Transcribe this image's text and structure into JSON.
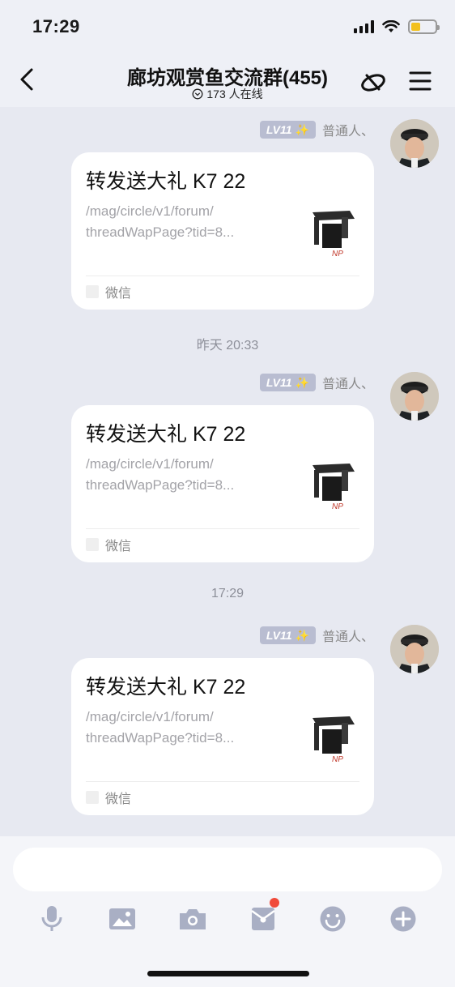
{
  "status_bar": {
    "time": "17:29"
  },
  "header": {
    "title": "廊坊观赏鱼交流群(455)",
    "online_text": "173 人在线"
  },
  "messages": [
    {
      "level": "LV11",
      "sender": "普通人、",
      "card_title": "转发送大礼 K7 22",
      "card_desc_line1": "/mag/circle/v1/forum/",
      "card_desc_line2": "threadWapPage?tid=8...",
      "card_source": "微信"
    },
    {
      "level": "LV11",
      "sender": "普通人、",
      "card_title": "转发送大礼 K7 22",
      "card_desc_line1": "/mag/circle/v1/forum/",
      "card_desc_line2": "threadWapPage?tid=8...",
      "card_source": "微信"
    },
    {
      "level": "LV11",
      "sender": "普通人、",
      "card_title": "转发送大礼 K7 22",
      "card_desc_line1": "/mag/circle/v1/forum/",
      "card_desc_line2": "threadWapPage?tid=8...",
      "card_source": "微信"
    }
  ],
  "time_separators": [
    "昨天 20:33",
    "17:29"
  ],
  "colors": {
    "background": "#eef0f6",
    "chat_background": "#e7e9f1",
    "level_badge": "#b9bdd1",
    "toolbar_icon": "#a9afc4",
    "notification_dot": "#f04a3a"
  },
  "toolbar": {
    "icons": [
      "microphone-icon",
      "image-icon",
      "camera-icon",
      "red-packet-icon",
      "emoji-icon",
      "plus-icon"
    ]
  }
}
